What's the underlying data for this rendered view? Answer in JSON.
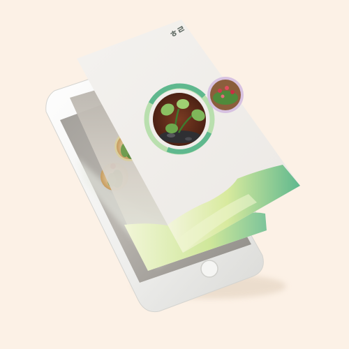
{
  "scene": {
    "background_color": "#fcf1e6",
    "description_tags": [
      "phone-mockup",
      "plant-app",
      "exploded-screen-layers"
    ]
  },
  "app": {
    "logo_text": "ㅎㄹ",
    "accent_green": "#5fb88e",
    "accent_lime": "#d6e8a0",
    "screens": [
      {
        "layer": "front",
        "items": [
          "pothos-plant-card",
          "flowering-cactus-card"
        ]
      },
      {
        "layer": "middle",
        "items": [
          "cactus-card"
        ]
      },
      {
        "layer": "back",
        "items": [
          "cactus-card",
          "scroll-indicator"
        ]
      }
    ]
  },
  "device": {
    "color": "#f2f2f0",
    "home_button": true
  }
}
